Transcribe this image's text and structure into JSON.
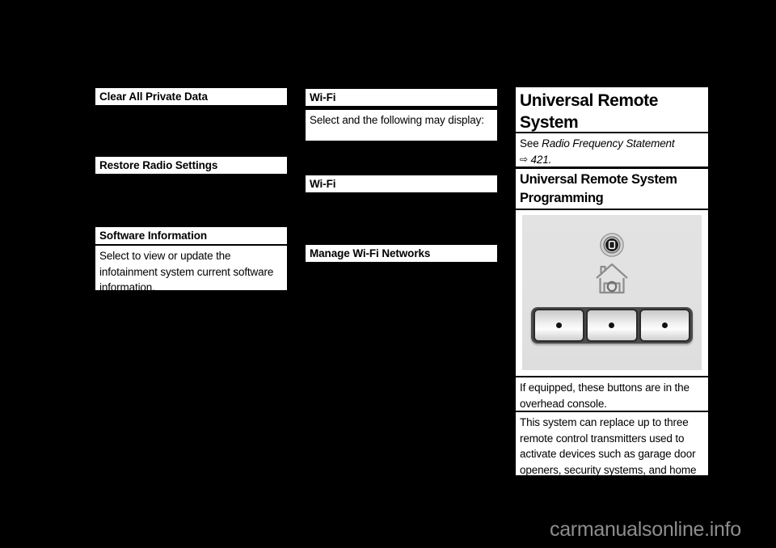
{
  "page": {
    "background_color": "#000000",
    "text_color": "#000000",
    "box_color": "#ffffff",
    "watermark": "carmanualsonline.info",
    "watermark_color": "#8d8d8d"
  },
  "column1": {
    "clear_all_private_data": {
      "heading": "Clear All Private Data"
    },
    "restore_radio_settings": {
      "heading": "Restore Radio Settings"
    },
    "software_information": {
      "heading": "Software Information",
      "body": "Select to view or update the infotainment system current software information."
    }
  },
  "column2": {
    "wifi_1": {
      "heading": "Wi-Fi",
      "body": "Select and the following may display:"
    },
    "wifi_2": {
      "heading": "Wi-Fi"
    },
    "manage_wifi_networks": {
      "heading": "Manage Wi-Fi Networks"
    }
  },
  "column3": {
    "universal_remote_system": {
      "heading": "Universal Remote System"
    },
    "radio_frequency_reference": {
      "prefix": "See ",
      "italic_title": "Radio Frequency Statement",
      "arrow": "⇨",
      "page_ref": "421."
    },
    "universal_remote_system_programming": {
      "heading": "Universal Remote System Programming"
    },
    "console_figure": {
      "led_indicator_label": "led-indicator",
      "house_icon_label": "house-icon",
      "buttons": [
        "button-1",
        "button-2",
        "button-3"
      ],
      "panel_color": "#e1e1e1"
    },
    "overhead_console_note": {
      "body": "If equipped, these buttons are in the overhead console."
    },
    "universal_remote_description": {
      "body": "This system can replace up to three remote control transmitters used to activate devices such as garage door openers, security systems, and home automation devices. These"
    }
  }
}
